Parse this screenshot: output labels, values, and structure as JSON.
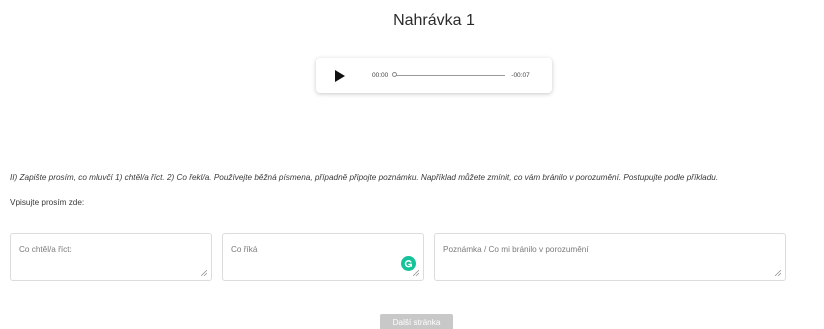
{
  "page": {
    "title": "Nahrávka 1"
  },
  "player": {
    "current_time": "00:00",
    "remaining_time": "-00:07",
    "progress": 0
  },
  "instruction": "II) Zapište prosím, co mluvčí 1) chtěl/a říct. 2) Co řekl/a. Používejte běžná písmena, případně připojte poznámku. Například můžete zmínit, co vám bránilo v porozumění. Postupujte podle příkladu.",
  "prompt": "Vpisujte prosím zde:",
  "fields": [
    {
      "placeholder": "Co chtěl/a říct:",
      "value": ""
    },
    {
      "placeholder": "Co říká",
      "value": ""
    },
    {
      "placeholder": "Poznámka / Co mi bránilo v porozumění",
      "value": ""
    }
  ],
  "next_button": {
    "label": "Další stránka",
    "disabled": true
  },
  "colors": {
    "grammarly": "#15c39a",
    "button_disabled": "#c8c8c8"
  }
}
